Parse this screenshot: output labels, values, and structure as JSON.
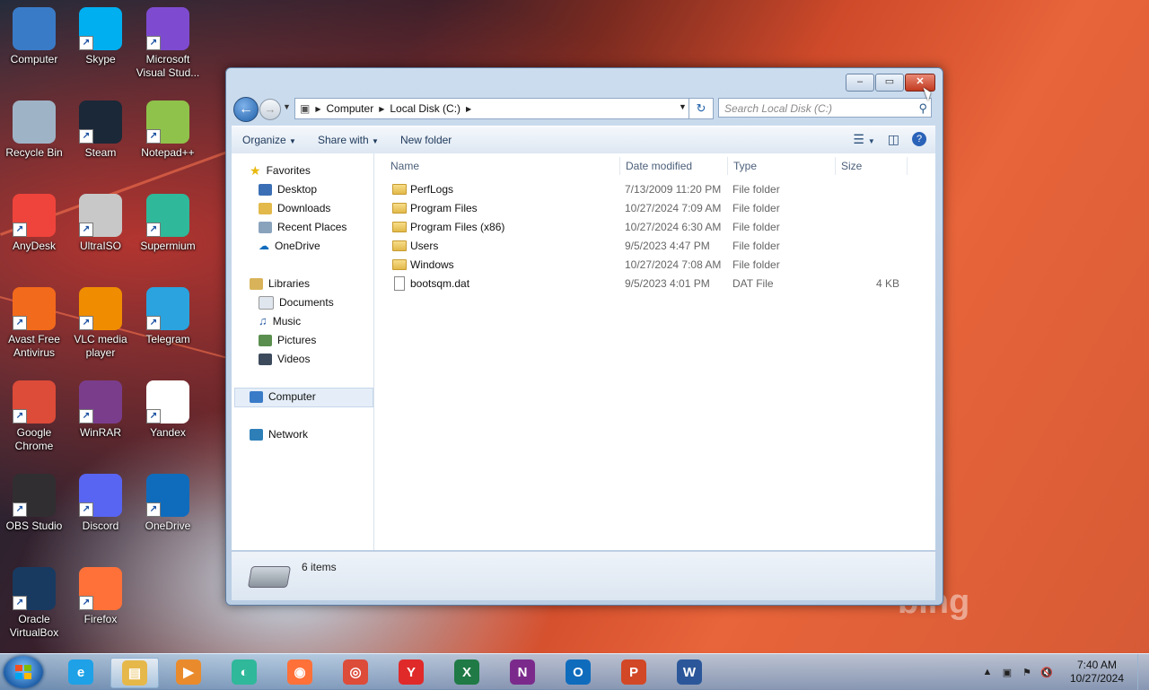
{
  "desktop": {
    "icons": [
      {
        "label": "Computer",
        "icon": "computer-icon",
        "color": "#3a7bc8"
      },
      {
        "label": "Skype",
        "icon": "skype-icon",
        "color": "#00aff0"
      },
      {
        "label": "Microsoft Visual Stud...",
        "icon": "visual-studio-icon",
        "color": "#7e4bd0"
      },
      {
        "label": "Recycle Bin",
        "icon": "recycle-bin-icon",
        "color": "#9fb3c6"
      },
      {
        "label": "Steam",
        "icon": "steam-icon",
        "color": "#1b2838"
      },
      {
        "label": "Notepad++",
        "icon": "notepad-plus-plus-icon",
        "color": "#8fc24a"
      },
      {
        "label": "AnyDesk",
        "icon": "anydesk-icon",
        "color": "#ef443b"
      },
      {
        "label": "UltraISO",
        "icon": "ultraiso-icon",
        "color": "#c8c8c8"
      },
      {
        "label": "Supermium",
        "icon": "supermium-icon",
        "color": "#2fb89a"
      },
      {
        "label": "Avast Free Antivirus",
        "icon": "avast-icon",
        "color": "#f26a1b"
      },
      {
        "label": "VLC media player",
        "icon": "vlc-icon",
        "color": "#f08c00"
      },
      {
        "label": "Telegram",
        "icon": "telegram-icon",
        "color": "#2aa3df"
      },
      {
        "label": "Google Chrome",
        "icon": "chrome-icon",
        "color": "#dd4b39"
      },
      {
        "label": "WinRAR",
        "icon": "winrar-icon",
        "color": "#7a3d8c"
      },
      {
        "label": "Yandex",
        "icon": "yandex-icon",
        "color": "#ffffff"
      },
      {
        "label": "OBS Studio",
        "icon": "obs-icon",
        "color": "#302e31"
      },
      {
        "label": "Discord",
        "icon": "discord-icon",
        "color": "#5865f2"
      },
      {
        "label": "OneDrive",
        "icon": "onedrive-icon",
        "color": "#0f6cbd"
      },
      {
        "label": "Oracle VirtualBox",
        "icon": "virtualbox-icon",
        "color": "#183a61"
      },
      {
        "label": "Firefox",
        "icon": "firefox-icon",
        "color": "#ff7139"
      }
    ],
    "watermark": "bing"
  },
  "window": {
    "caption": {
      "minimize": "‒",
      "maximize": "▭",
      "close": "✕"
    },
    "address": {
      "crumbs": [
        "Computer",
        "Local Disk (C:)"
      ],
      "search_placeholder": "Search Local Disk (C:)"
    },
    "toolbar": {
      "organize": "Organize",
      "share_with": "Share with",
      "new_folder": "New folder"
    },
    "nav": {
      "favorites": "Favorites",
      "desktop": "Desktop",
      "downloads": "Downloads",
      "recent_places": "Recent Places",
      "onedrive": "OneDrive",
      "libraries": "Libraries",
      "documents": "Documents",
      "music": "Music",
      "pictures": "Pictures",
      "videos": "Videos",
      "computer": "Computer",
      "network": "Network"
    },
    "columns": {
      "name": "Name",
      "date": "Date modified",
      "type": "Type",
      "size": "Size"
    },
    "files": [
      {
        "name": "PerfLogs",
        "date": "7/13/2009 11:20 PM",
        "type": "File folder",
        "size": "",
        "kind": "folder"
      },
      {
        "name": "Program Files",
        "date": "10/27/2024 7:09 AM",
        "type": "File folder",
        "size": "",
        "kind": "folder"
      },
      {
        "name": "Program Files (x86)",
        "date": "10/27/2024 6:30 AM",
        "type": "File folder",
        "size": "",
        "kind": "folder"
      },
      {
        "name": "Users",
        "date": "9/5/2023 4:47 PM",
        "type": "File folder",
        "size": "",
        "kind": "folder"
      },
      {
        "name": "Windows",
        "date": "10/27/2024 7:08 AM",
        "type": "File folder",
        "size": "",
        "kind": "folder"
      },
      {
        "name": "bootsqm.dat",
        "date": "9/5/2023 4:01 PM",
        "type": "DAT File",
        "size": "4 KB",
        "kind": "file"
      }
    ],
    "status": {
      "count": "6 items"
    }
  },
  "taskbar": {
    "apps": [
      {
        "icon": "internet-explorer-icon",
        "glyph": "e",
        "color": "#1ea1e6"
      },
      {
        "icon": "file-explorer-icon",
        "glyph": "▤",
        "color": "#e6b84a",
        "active": true
      },
      {
        "icon": "media-player-icon",
        "glyph": "▶",
        "color": "#e98b2c"
      },
      {
        "icon": "supermium-icon",
        "glyph": "◐",
        "color": "#2fb89a"
      },
      {
        "icon": "firefox-icon",
        "glyph": "◉",
        "color": "#ff7139"
      },
      {
        "icon": "chrome-icon",
        "glyph": "◎",
        "color": "#dd4b39"
      },
      {
        "icon": "yandex-icon",
        "glyph": "Y",
        "color": "#e02a2a"
      },
      {
        "icon": "excel-icon",
        "glyph": "X",
        "color": "#1f7a45"
      },
      {
        "icon": "onenote-icon",
        "glyph": "N",
        "color": "#7b2a8c"
      },
      {
        "icon": "outlook-icon",
        "glyph": "O",
        "color": "#0f6cbd"
      },
      {
        "icon": "powerpoint-icon",
        "glyph": "P",
        "color": "#d24726"
      },
      {
        "icon": "word-icon",
        "glyph": "W",
        "color": "#2b579a"
      }
    ],
    "clock": {
      "time": "7:40 AM",
      "date": "10/27/2024"
    }
  }
}
